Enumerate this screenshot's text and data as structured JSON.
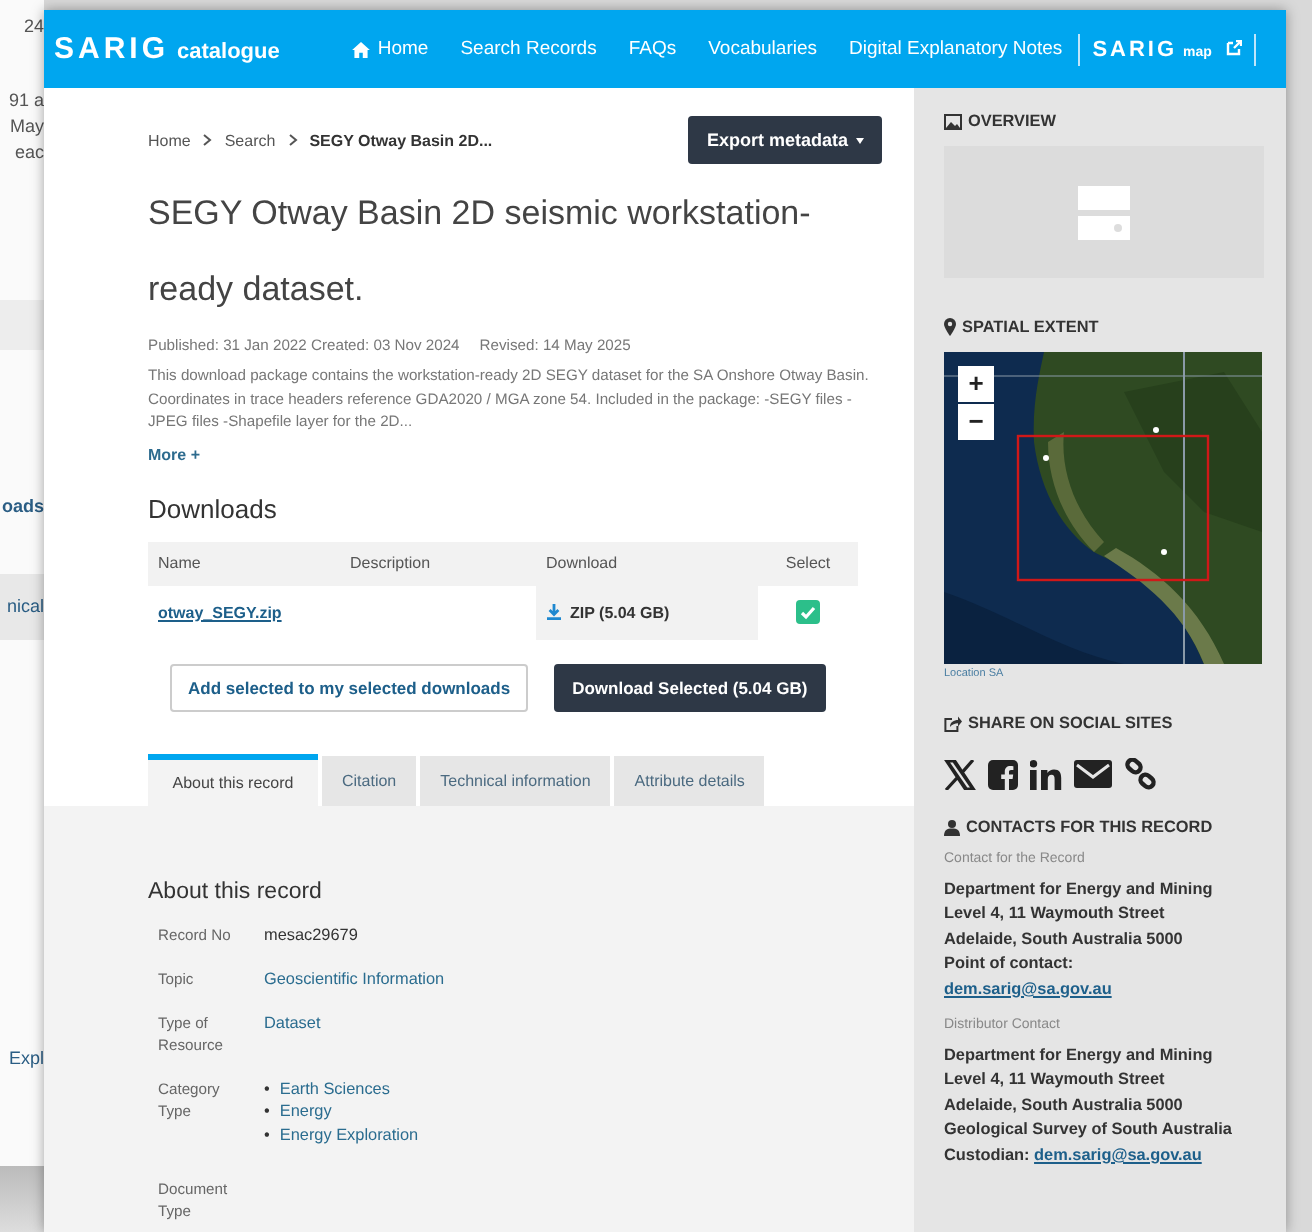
{
  "background_window": {
    "fragments": [
      "24",
      "91 a",
      "May",
      "eac",
      "oads",
      "nical",
      "Expl"
    ]
  },
  "header": {
    "logo": "SARIG",
    "logo_sub": "catalogue",
    "nav": [
      {
        "label": "Home"
      },
      {
        "label": "Search Records"
      },
      {
        "label": "FAQs"
      },
      {
        "label": "Vocabularies"
      },
      {
        "label": "Digital Explanatory Notes"
      }
    ],
    "map_logo": "SARIG",
    "map_logo_sub": "map"
  },
  "breadcrumb": [
    "Home",
    "Search",
    "SEGY Otway Basin 2D..."
  ],
  "export_button": "Export metadata",
  "title": "SEGY Otway Basin 2D seismic workstation-ready dataset.",
  "dates": [
    "Published: 31 Jan 2022 Created: 03 Nov 2024",
    "Revised: 14 May 2025"
  ],
  "description": "This download package contains the workstation-ready 2D SEGY dataset for the SA Onshore Otway Basin. Coordinates in trace headers reference GDA2020 / MGA zone 54. Included in the package: -SEGY files -JPEG files -Shapefile layer for the 2D...",
  "more_link": "More +",
  "downloads": {
    "heading": "Downloads",
    "columns": [
      "Name",
      "Description",
      "Download",
      "Select"
    ],
    "rows": [
      {
        "name": "otway_SEGY.zip",
        "download": "ZIP (5.04 GB)",
        "checked": true
      }
    ]
  },
  "buttons": [
    "Add selected to my selected downloads",
    "Download Selected (5.04 GB)"
  ],
  "tabs": [
    {
      "label": "About this record",
      "selected": true
    },
    {
      "label": "Citation",
      "selected": false
    },
    {
      "label": "Technical information",
      "selected": false
    },
    {
      "label": "Attribute details",
      "selected": false
    }
  ],
  "about": {
    "heading": "About this record",
    "fields": [
      {
        "label": "Record No",
        "kind": "text",
        "value": "mesac29679"
      },
      {
        "label": "Topic",
        "kind": "link",
        "value": "Geoscientific Information"
      },
      {
        "label": "Type of Resource",
        "kind": "link",
        "value": "Dataset"
      },
      {
        "label": "Category Type",
        "kind": "list",
        "bullet": "•",
        "values": [
          "Earth Sciences",
          "Energy",
          "Energy Exploration"
        ]
      },
      {
        "label": "Document Type",
        "kind": "none"
      }
    ]
  },
  "sidebar": {
    "overview": "OVERVIEW",
    "spatial_extent": "SPATIAL EXTENT",
    "map_zoom": [
      "+",
      "−"
    ],
    "map_caption": "Location SA",
    "share": "SHARE ON SOCIAL SITES",
    "contacts_heading": "CONTACTS FOR THIS RECORD",
    "contacts": [
      {
        "role": "Contact for the Record",
        "lines": [
          "Department for Energy and Mining",
          "Level 4, 11 Waymouth Street",
          "Adelaide, South Australia 5000",
          "Point of contact:"
        ],
        "email": "dem.sarig@sa.gov.au"
      },
      {
        "role": "Distributor Contact",
        "lines": [
          "Department for Energy and Mining",
          "Level 4, 11 Waymouth Street",
          "Adelaide, South Australia 5000",
          "Geological Survey of South Australia"
        ],
        "email_prefix": "Custodian:",
        "email": "dem.sarig@sa.gov.au"
      }
    ]
  }
}
